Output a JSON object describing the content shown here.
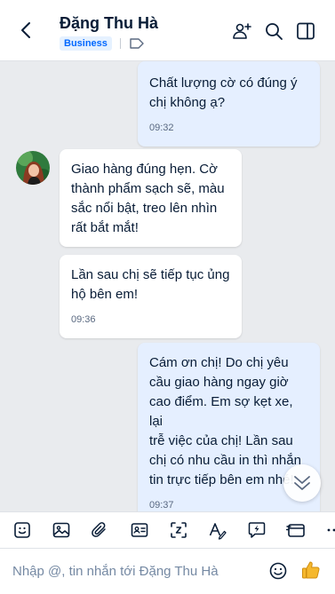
{
  "header": {
    "title": "Đặng Thu Hà",
    "badge": "Business"
  },
  "messages": [
    {
      "sender": "me",
      "text": "Chất lượng cờ có đúng ý\nchị không ạ?",
      "time": "09:32"
    },
    {
      "sender": "contact",
      "text": "Giao hàng đúng hẹn. Cờ\nthành phẩm sạch sẽ, màu\nsắc nổi bật, treo lên nhìn\nrất bắt mắt!"
    },
    {
      "sender": "contact",
      "text": "Lần sau chị sẽ tiếp tục ủng\nhộ bên em!",
      "time": "09:36"
    },
    {
      "sender": "me",
      "text": "Cám ơn chị! Do chị yêu\ncầu giao hàng ngay giờ\ncao điểm. Em sợ kẹt xe, lại\ntrễ việc của chị! Lần sau\nchị có nhu cầu in thì nhắn\ntin trực tiếp bên em nhé!",
      "time": "09:37"
    }
  ],
  "toolbar": {
    "icons": [
      "sticker-icon",
      "image-icon",
      "attachment-icon",
      "contact-card-icon",
      "screenshot-icon",
      "text-format-icon",
      "quick-message-icon",
      "payment-card-icon",
      "more-icon"
    ]
  },
  "composer": {
    "placeholder": "Nhập @, tin nhắn tới Đặng Thu Hà"
  },
  "colors": {
    "accent": "#0068ff",
    "sent_bubble": "#e5efff",
    "received_bubble": "#ffffff",
    "background": "#e9ebee"
  }
}
